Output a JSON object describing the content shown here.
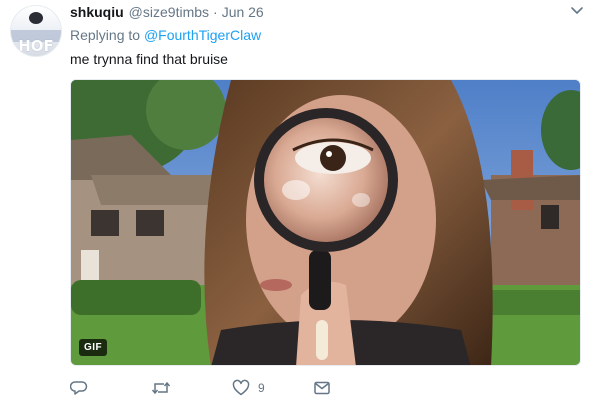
{
  "tweet": {
    "avatar_text": "HOF",
    "display_name": "shkuqiu",
    "handle": "@size9timbs",
    "separator": "·",
    "date": "Jun 26",
    "reply_prefix": "Replying to ",
    "reply_mention": "@FourthTigerClaw",
    "text": "me trynna find that bruise",
    "media": {
      "badge": "GIF"
    },
    "actions": {
      "reply": {
        "icon": "reply-icon"
      },
      "retweet": {
        "icon": "retweet-icon"
      },
      "like": {
        "icon": "heart-icon",
        "count": "9"
      },
      "message": {
        "icon": "envelope-icon"
      }
    }
  },
  "colors": {
    "text": "#14171a",
    "secondary": "#657786",
    "accent": "#1da1f2",
    "divider": "#e6ecf0"
  }
}
